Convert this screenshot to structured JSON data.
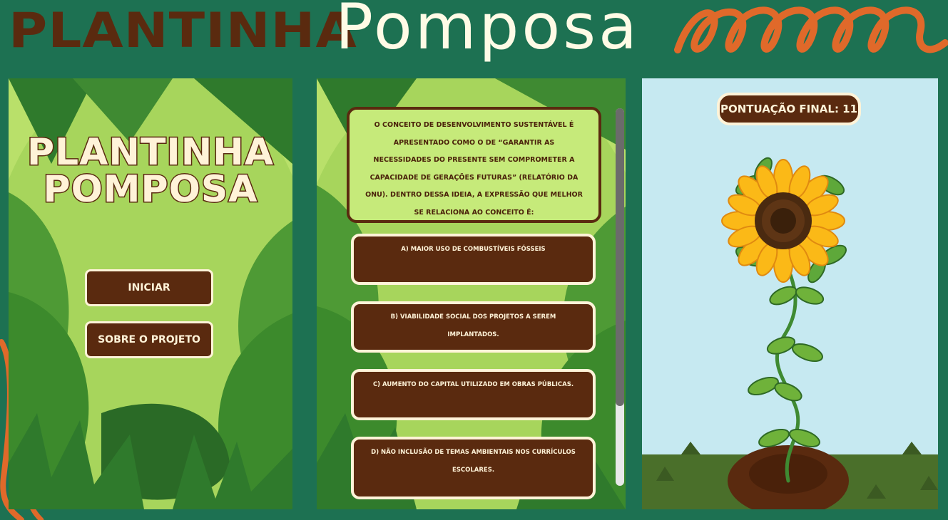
{
  "header": {
    "title_part1": "PLANTINHA",
    "title_part2": "Pomposa"
  },
  "screen_menu": {
    "logo_line1": "PLANTINHA",
    "logo_line2": "POMPOSA",
    "start_button": "INICIAR",
    "about_button": "SOBRE O PROJETO"
  },
  "screen_quiz": {
    "question": "O conceito de desenvolvimento sustentável é apresentado como o de “garantir as necessidades do presente sem comprometer a capacidade de gerações futuras” (Relatório da ONU). Dentro dessa ideia, a expressão que melhor se relaciona ao conceito é:",
    "answers": [
      "a) maior uso de combustíveis fósseis",
      "b) viabilidade social dos projetos a serem implantados.",
      "c) aumento do capital utilizado em obras públicas.",
      "d) não inclusão de temas ambientais nos currículos escolares."
    ]
  },
  "screen_result": {
    "score_label": "PONTUAÇÃO FINAL: 11"
  },
  "colors": {
    "background": "#1d7152",
    "brown": "#5a2a0f",
    "cream": "#fff3d8",
    "accent_orange": "#e0692a",
    "sky": "#c6e9f1"
  }
}
